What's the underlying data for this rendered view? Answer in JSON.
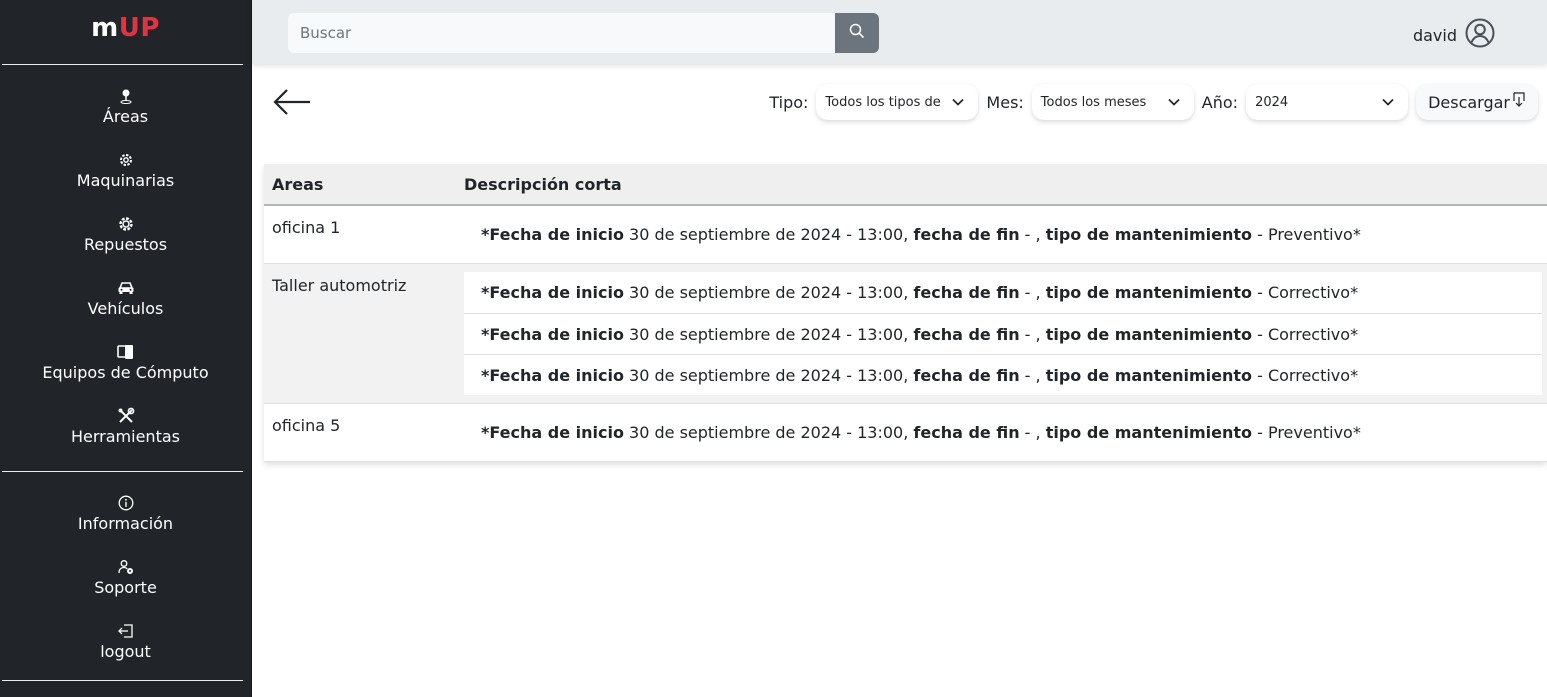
{
  "brand": {
    "prefix": "m",
    "accent": "UP",
    "accent_color": "#dc3545"
  },
  "sidebar": {
    "items": [
      {
        "label": "Áreas",
        "icon": "pin-icon"
      },
      {
        "label": "Maquinarias",
        "icon": "gear-icon"
      },
      {
        "label": "Repuestos",
        "icon": "cog-icon"
      },
      {
        "label": "Vehículos",
        "icon": "car-icon"
      },
      {
        "label": "Equipos de Cómputo",
        "icon": "devices-icon"
      },
      {
        "label": "Herramientas",
        "icon": "tools-icon"
      }
    ],
    "secondary": [
      {
        "label": "Información",
        "icon": "info-icon"
      },
      {
        "label": "Soporte",
        "icon": "support-icon"
      },
      {
        "label": "logout",
        "icon": "logout-icon"
      }
    ]
  },
  "topbar": {
    "search_placeholder": "Buscar",
    "user_name": "david"
  },
  "filters": {
    "tipo_label": "Tipo:",
    "tipo_value": "Todos los tipos de",
    "mes_label": "Mes:",
    "mes_value": "Todos los meses",
    "anio_label": "Año:",
    "anio_value": "2024",
    "download_label": "Descargar"
  },
  "table": {
    "headers": {
      "area": "Areas",
      "desc": "Descripción corta"
    },
    "desc_labels": {
      "prefix": "*",
      "start": "Fecha de inicio",
      "end": "fecha de fin",
      "type": "tipo de mantenimiento",
      "suffix": "*"
    },
    "rows": [
      {
        "area": "oficina 1",
        "items": [
          {
            "start": " 30 de septiembre de 2024 - 13:00, ",
            "end": " - , ",
            "type": " - Preventivo"
          }
        ]
      },
      {
        "area": "Taller automotriz",
        "items": [
          {
            "start": " 30 de septiembre de 2024 - 13:00, ",
            "end": " - , ",
            "type": " - Correctivo"
          },
          {
            "start": " 30 de septiembre de 2024 - 13:00, ",
            "end": " - , ",
            "type": " - Correctivo"
          },
          {
            "start": " 30 de septiembre de 2024 - 13:00, ",
            "end": " - , ",
            "type": " - Correctivo"
          }
        ]
      },
      {
        "area": "oficina 5",
        "items": [
          {
            "start": " 30 de septiembre de 2024 - 13:00, ",
            "end": " - , ",
            "type": " - Preventivo"
          }
        ]
      }
    ]
  }
}
